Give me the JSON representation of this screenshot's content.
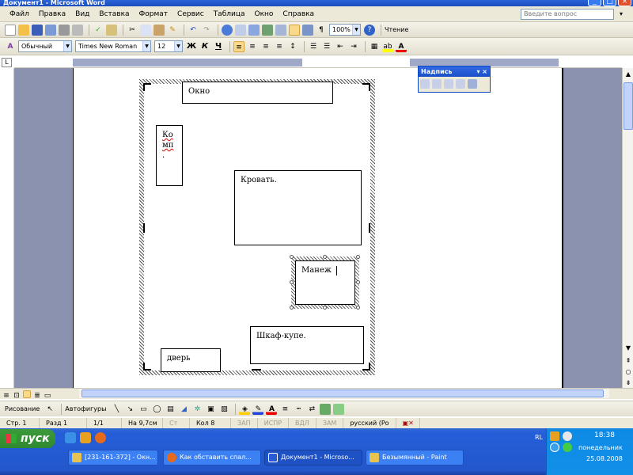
{
  "window": {
    "title": "Документ1 - Microsoft Word"
  },
  "menubar": {
    "items": [
      "Файл",
      "Правка",
      "Вид",
      "Вставка",
      "Формат",
      "Сервис",
      "Таблица",
      "Окно",
      "Справка"
    ],
    "help_placeholder": "Введите вопрос"
  },
  "toolbar_standard": {
    "zoom": "100%",
    "reading": "Чтение"
  },
  "toolbar_format": {
    "style": "Обычный",
    "font": "Times New Roman",
    "size": "12",
    "bold": "Ж",
    "italic": "К",
    "underline": "Ч"
  },
  "floating_toolbar": {
    "title": "Надпись"
  },
  "drawing": {
    "boxes": {
      "okno": "Окно",
      "komp_line1": "Ко",
      "komp_line2": "мп",
      "komp_line3": ".",
      "krovat": "Кровать.",
      "manezh": "Манеж",
      "shkaf": "Шкаф-купе.",
      "dver": "дверь"
    }
  },
  "drawbar": {
    "draw": "Рисование",
    "autoshapes": "Автофигуры"
  },
  "statusbar": {
    "page": "Стр. 1",
    "section": "Разд 1",
    "pages": "1/1",
    "at": "На 9,7см",
    "line": "Ст",
    "col": "Кол 8",
    "rec": "ЗАП",
    "trk": "ИСПР",
    "ext": "ВДЛ",
    "ovr": "ЗАМ",
    "lang": "русский (Ро"
  },
  "taskbar": {
    "start": "пуск",
    "tasks": [
      "[231-161-372] - Окн...",
      "Как обставить спал...",
      "Документ1 - Microso...",
      "Безымянный - Paint"
    ],
    "lang": "RL",
    "time": "18:38",
    "day": "понедельник",
    "date": "25.08.2008"
  },
  "colors": {
    "accent": "#2a63d8",
    "chrome": "#ece9d8",
    "doc_bg": "#8b92b0",
    "taskbar": "#245ed8",
    "start": "#3c9a3a"
  }
}
